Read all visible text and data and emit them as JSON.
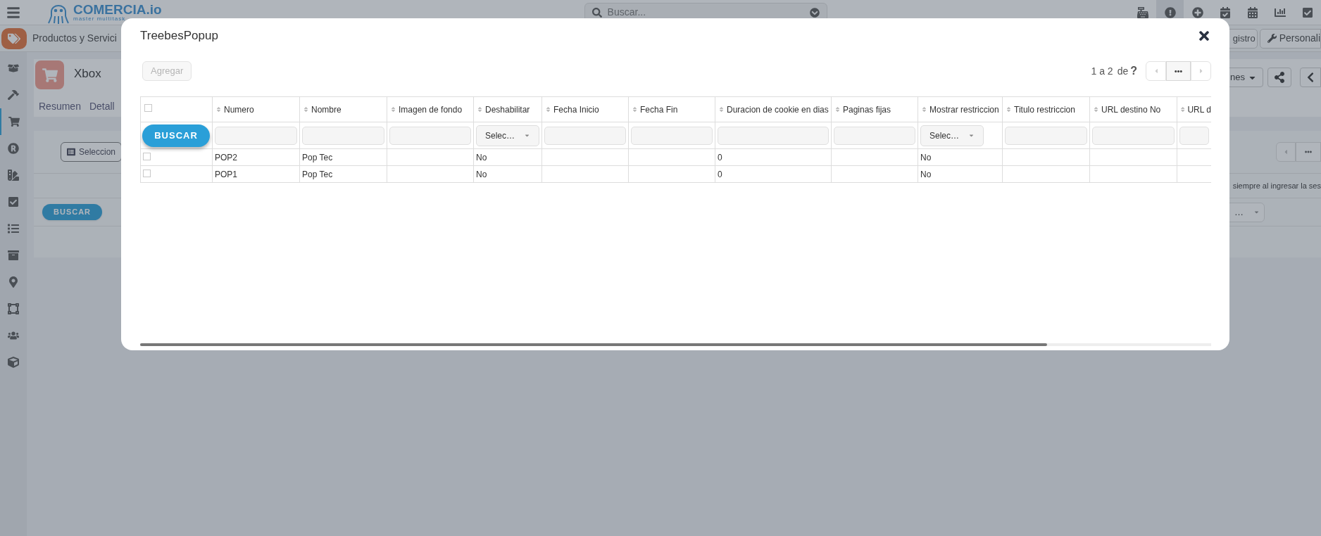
{
  "topbar": {
    "logo": {
      "name": "COMERCIA.io",
      "tagline": "master multitask"
    },
    "search": {
      "placeholder": "Buscar..."
    }
  },
  "module_bar": {
    "title": "Productos y Servici",
    "buttons": [
      "gistro",
      "Personali"
    ]
  },
  "record": {
    "title": "Xbox",
    "tabs": [
      "Resumen",
      "Detall"
    ],
    "actions_label": "nes"
  },
  "background_list": {
    "select_button": "Seleccion",
    "column_header": "siempre al ingresar la ses",
    "search_button": "BUSCAR",
    "filter_select": "…"
  },
  "popup": {
    "title": "TreebesPopup",
    "add_button": {
      "label": "Agregar",
      "disabled": true
    },
    "pagination": {
      "range": "1 a 2",
      "of": "de",
      "total": "?",
      "prev_disabled": true,
      "next_disabled": true
    },
    "table": {
      "select_all": {
        "checked": false
      },
      "search_button": "BUSCAR",
      "columns": [
        {
          "label": "Numero",
          "filter": {
            "kind": "text"
          }
        },
        {
          "label": "Nombre",
          "filter": {
            "kind": "text"
          }
        },
        {
          "label": "Imagen de fondo",
          "filter": {
            "kind": "text"
          }
        },
        {
          "label": "Deshabilitar",
          "filter": {
            "kind": "select",
            "value": "Selec…"
          }
        },
        {
          "label": "Fecha Inicio",
          "filter": {
            "kind": "text"
          }
        },
        {
          "label": "Fecha Fin",
          "filter": {
            "kind": "text"
          }
        },
        {
          "label": "Duracion de cookie en dias",
          "filter": {
            "kind": "text"
          }
        },
        {
          "label": "Paginas fijas",
          "filter": {
            "kind": "text"
          }
        },
        {
          "label": "Mostrar restriccion",
          "filter": {
            "kind": "select",
            "value": "Selec…"
          }
        },
        {
          "label": "Titulo restriccion",
          "filter": {
            "kind": "text"
          }
        },
        {
          "label": "URL destino No",
          "filter": {
            "kind": "text"
          }
        },
        {
          "label": "URL d",
          "filter": {
            "kind": "text"
          }
        }
      ],
      "rows": [
        {
          "checked": false,
          "cells": [
            "POP2",
            "Pop Tec",
            "",
            "No",
            "",
            "",
            "0",
            "",
            "No",
            "",
            "",
            ""
          ]
        },
        {
          "checked": false,
          "cells": [
            "POP1",
            "Pop Tec",
            "",
            "No",
            "",
            "",
            "0",
            "",
            "No",
            "",
            "",
            ""
          ]
        }
      ]
    }
  }
}
